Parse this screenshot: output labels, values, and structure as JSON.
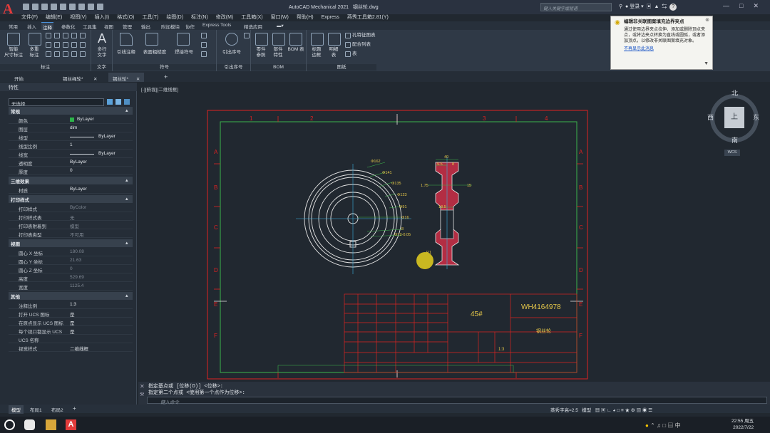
{
  "app": {
    "title": "AutoCAD Mechanical 2021",
    "file": "钢丝轮.dwg",
    "search_placeholder": "键入关键字或短语",
    "login": "登录"
  },
  "menu": [
    "文件(F)",
    "编辑(E)",
    "视图(V)",
    "插入(I)",
    "格式(O)",
    "工具(T)",
    "绘图(D)",
    "标注(N)",
    "修改(M)",
    "工具箱(X)",
    "窗口(W)",
    "帮助(H)",
    "Express",
    "燕秀工具箱2.81(Y)"
  ],
  "ribbon_tabs": [
    "常用",
    "插入",
    "注释",
    "参数化",
    "工具集",
    "视图",
    "管理",
    "输出",
    "附加模块",
    "协作",
    "Express Tools",
    "精选应用"
  ],
  "ribbon_groups": {
    "dim": {
      "label": "标注",
      "b1": "智能\n尺寸标注",
      "b2": "多重\n标注"
    },
    "text": {
      "label": "文字",
      "b1": "多行\n文字"
    },
    "symbol": {
      "label": "符号",
      "b1": "引线注释",
      "b2": "表面粗糙度",
      "b3": "焊接符号"
    },
    "leader": {
      "label": "引出序号",
      "b1": "引出序号"
    },
    "bom": {
      "label": "BOM",
      "b1": "零件\n参照",
      "b2": "部件\n特性",
      "b3": "BOM 表"
    },
    "table": {
      "label": "图纸",
      "b1": "标题\n边框",
      "b2": "明细\n表",
      "r1": "孔特征图表",
      "r2": "配合列表",
      "r3": "表"
    }
  },
  "tooltip": {
    "title": "编辑非关联图案填充边界夹点",
    "body": "通过使用边界夹点拉伸、添加或删除顶点夹点，或将边夹点转换为直线或圆弧，或者添加顶点，以修改非关联图案填充对象。",
    "link": "不再显示此消息"
  },
  "doc_tabs": [
    "开始",
    "钢丝绳轮*",
    "钢丝轮*"
  ],
  "props": {
    "header": "特性",
    "selection": "无选择",
    "sections": {
      "general": "常规",
      "threed": "三维效果",
      "print": "打印样式",
      "view": "视图",
      "misc": "其他"
    },
    "general": [
      {
        "k": "颜色",
        "v": "ByLayer"
      },
      {
        "k": "图层",
        "v": "dim"
      },
      {
        "k": "线型",
        "v": "ByLayer"
      },
      {
        "k": "线型比例",
        "v": "1"
      },
      {
        "k": "线宽",
        "v": "ByLayer"
      },
      {
        "k": "透明度",
        "v": "ByLayer"
      },
      {
        "k": "厚度",
        "v": "0"
      }
    ],
    "threed": [
      {
        "k": "材质",
        "v": "ByLayer"
      }
    ],
    "print": [
      {
        "k": "打印样式",
        "v": "ByColor"
      },
      {
        "k": "打印样式表",
        "v": "无"
      },
      {
        "k": "打印表附着到",
        "v": "模型"
      },
      {
        "k": "打印表类型",
        "v": "不可用"
      }
    ],
    "view": [
      {
        "k": "圆心 X 坐标",
        "v": "180.08"
      },
      {
        "k": "圆心 Y 坐标",
        "v": "21.63"
      },
      {
        "k": "圆心 Z 坐标",
        "v": "0"
      },
      {
        "k": "高度",
        "v": "529.69"
      },
      {
        "k": "宽度",
        "v": "1125.4"
      }
    ],
    "misc": [
      {
        "k": "注释比例",
        "v": "1:3"
      },
      {
        "k": "打开 UCS 图标",
        "v": "是"
      },
      {
        "k": "在原点显示 UCS 图标",
        "v": "是"
      },
      {
        "k": "每个视口都显示 UCS",
        "v": "是"
      },
      {
        "k": "UCS 名称",
        "v": ""
      },
      {
        "k": "视觉样式",
        "v": "二维线框"
      }
    ]
  },
  "viewport_label": "[-][俯视][二维线框]",
  "viewcube": {
    "n": "北",
    "s": "南",
    "e": "东",
    "w": "西",
    "top": "上",
    "ucs": "WCS"
  },
  "drawing": {
    "dims_circle": [
      "Φ162",
      "Φ141",
      "Φ135",
      "Φ123",
      "Φ91",
      "Φ16",
      "8",
      "Φ72-0.05"
    ],
    "dims_side": [
      "40",
      "9.5",
      "8",
      "1.75",
      "15",
      "18.5",
      "R1"
    ],
    "zone_cols": [
      "1",
      "2",
      "3",
      "4"
    ],
    "zone_rows": [
      "A",
      "B",
      "C",
      "D",
      "E",
      "F"
    ],
    "material": "45#",
    "drawing_no": "WH4164978",
    "part_name": "钢丝轮",
    "scale": "1:3"
  },
  "command": {
    "line1": "指定基点或 [位移(D)] <位移>:",
    "line2": "指定第二个点或 <使用第一个点作为位移>:",
    "placeholder": "键入命令"
  },
  "layout_tabs": [
    "模型",
    "布局1",
    "布局2"
  ],
  "status": {
    "text_height": "蒸秀字高=2.5",
    "mode": "模型"
  },
  "clock": {
    "time": "22:55 周五",
    "date": "2022/7/22"
  }
}
